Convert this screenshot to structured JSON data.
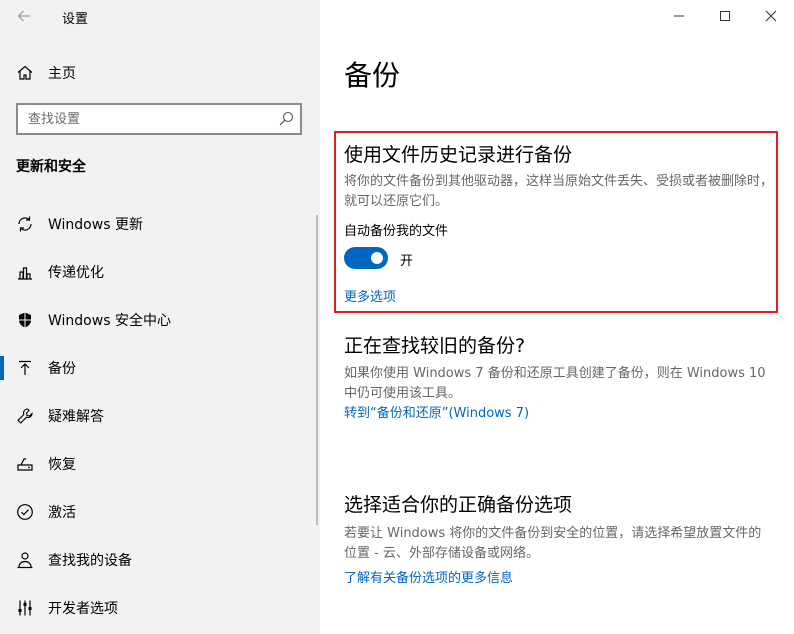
{
  "app": {
    "title": "设置"
  },
  "sidebar": {
    "home_label": "主页",
    "search_placeholder": "查找设置",
    "section_title": "更新和安全",
    "items": [
      {
        "label": "Windows 更新",
        "icon": "sync-icon"
      },
      {
        "label": "传递优化",
        "icon": "delivery-optimization-icon"
      },
      {
        "label": "Windows 安全中心",
        "icon": "shield-icon"
      },
      {
        "label": "备份",
        "icon": "backup-arrow-icon",
        "active": true
      },
      {
        "label": "疑难解答",
        "icon": "wrench-icon"
      },
      {
        "label": "恢复",
        "icon": "recovery-icon"
      },
      {
        "label": "激活",
        "icon": "check-circle-icon"
      },
      {
        "label": "查找我的设备",
        "icon": "person-locate-icon"
      },
      {
        "label": "开发者选项",
        "icon": "developer-sliders-icon"
      }
    ]
  },
  "main": {
    "title": "备份",
    "file_history": {
      "heading": "使用文件历史记录进行备份",
      "description": "将你的文件备份到其他驱动器，这样当原始文件丢失、受损或者被删除时，就可以还原它们。",
      "auto_backup_label": "自动备份我的文件",
      "toggle_state": "开",
      "more_options_link": "更多选项"
    },
    "older_backup": {
      "heading": "正在查找较旧的备份?",
      "description": "如果你使用 Windows 7 备份和还原工具创建了备份，则在 Windows 10 中仍可使用该工具。",
      "link": "转到“备份和还原”(Windows 7)"
    },
    "choose_option": {
      "heading": "选择适合你的正确备份选项",
      "description": "若要让 Windows 将你的文件备份到安全的位置，请选择希望放置文件的位置 - 云、外部存储设备或网络。",
      "link": "了解有关备份选项的更多信息"
    }
  },
  "colors": {
    "accent": "#0067c0",
    "highlight_border": "#e02020",
    "sidebar_bg": "#f2f2f2"
  }
}
